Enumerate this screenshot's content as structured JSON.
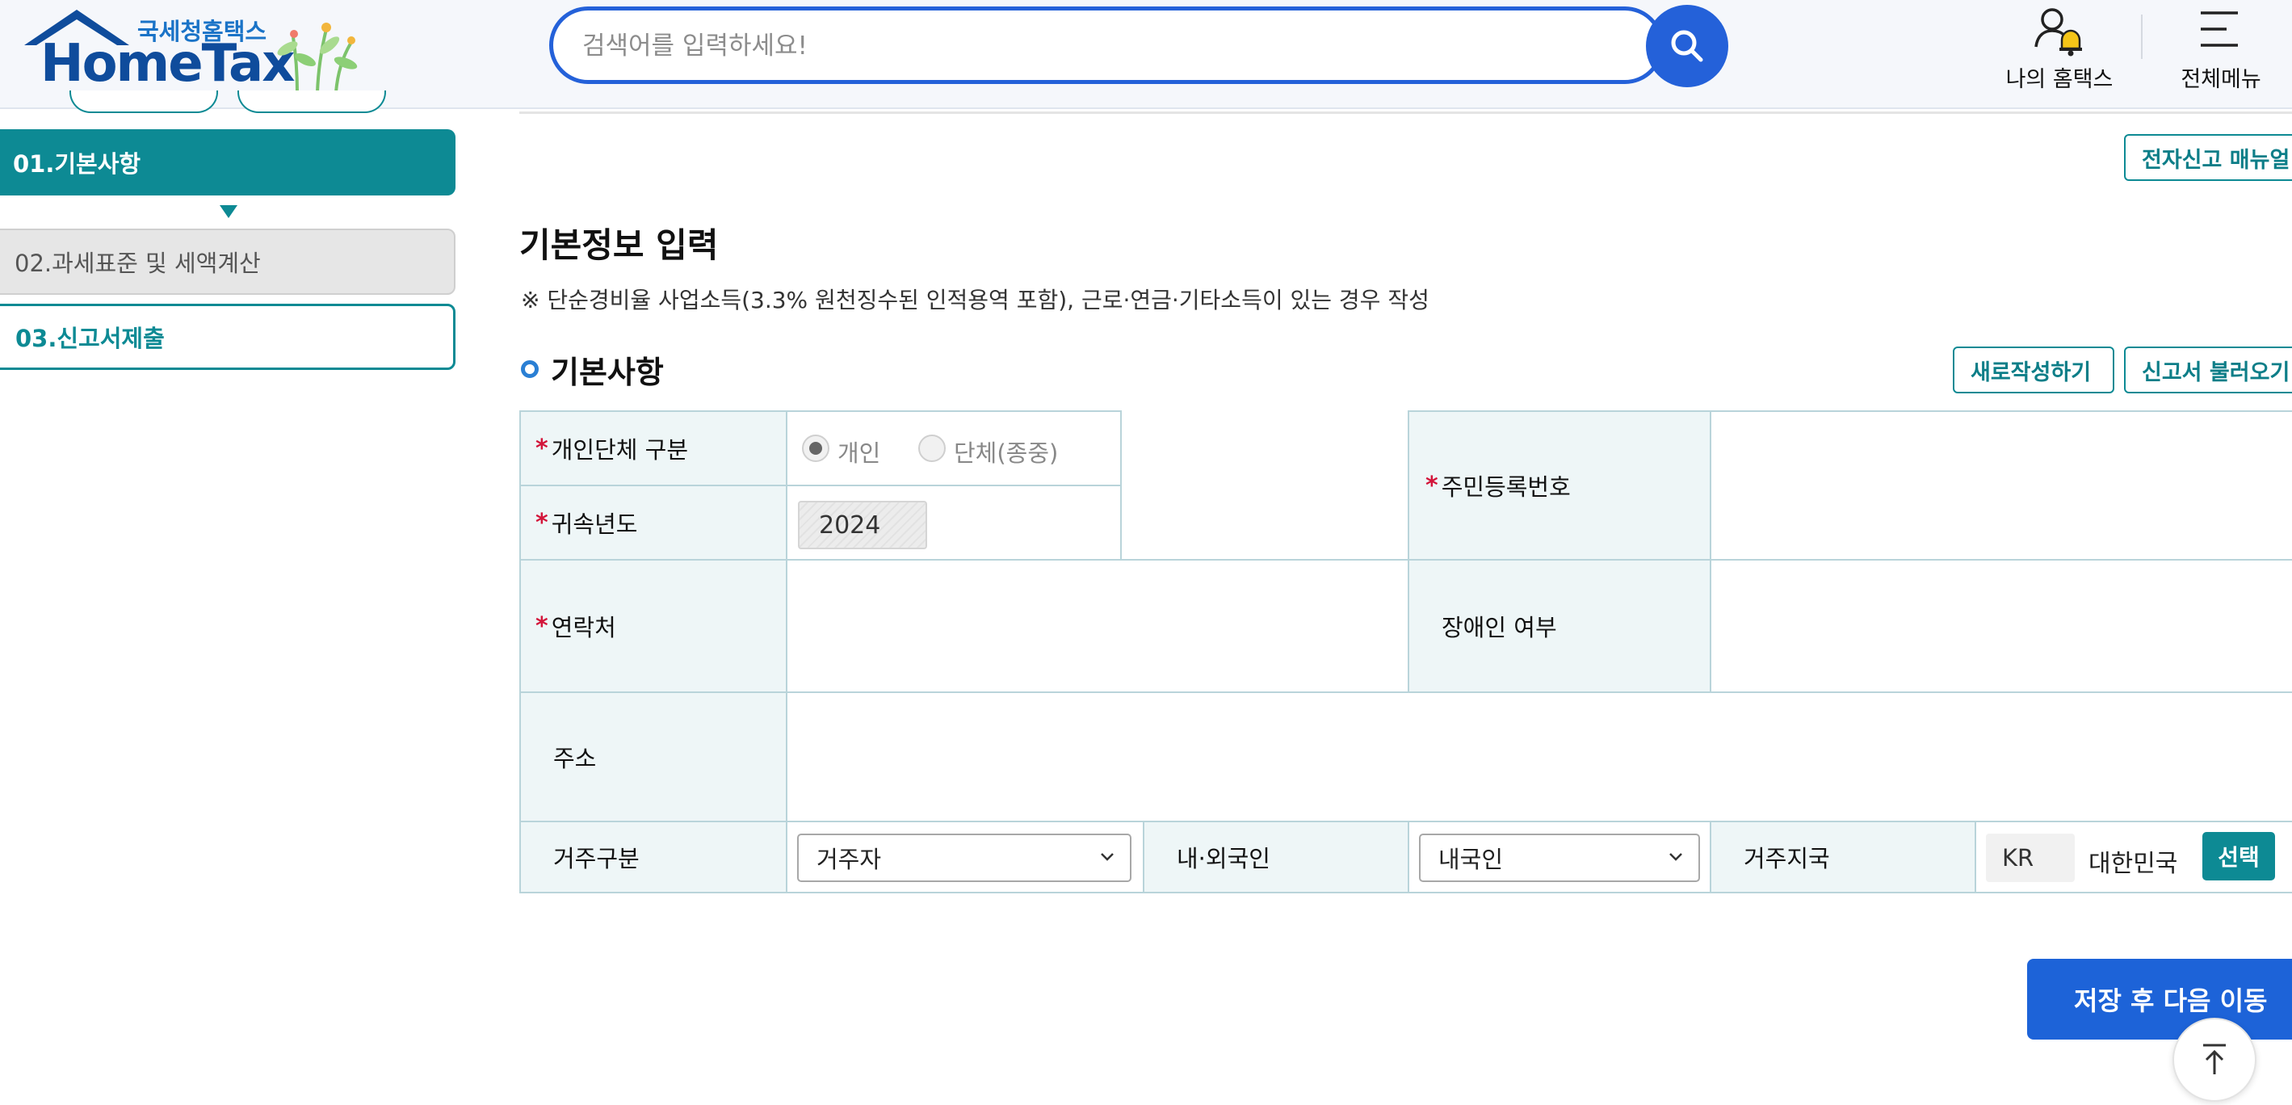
{
  "header": {
    "logo_sub": "국세청홈택스",
    "logo_main": "HomeTax",
    "search": {
      "placeholder": "검색어를 입력하세요!"
    },
    "my_hometax_label": "나의 홈택스",
    "all_menu_label": "전체메뉴"
  },
  "sidebar": {
    "steps": [
      {
        "label": "01.기본사항",
        "state": "active"
      },
      {
        "label": "02.과세표준 및 세액계산",
        "state": "disabled"
      },
      {
        "label": "03.신고서제출",
        "state": "enabled"
      }
    ]
  },
  "main": {
    "manual_button": "전자신고 매뉴얼",
    "title": "기본정보 입력",
    "note": "※ 단순경비율 사업소득(3.3% 원천징수된 인적용역 포함), 근로·연금·기타소득이 있는 경우 작성",
    "section_title": "기본사항",
    "new_button": "새로작성하기",
    "load_button": "신고서 불러오기"
  },
  "form": {
    "type_label": "개인단체 구분",
    "type_options": [
      "개인",
      "단체(종중)"
    ],
    "type_selected": "개인",
    "year_label": "귀속년도",
    "year_value": "2024",
    "rrn_label": "주민등록번호",
    "contact_label": "연락처",
    "disabled_label": "장애인 여부",
    "address_label": "주소",
    "residence_label": "거주구분",
    "residence_value": "거주자",
    "nationality_label": "내·외국인",
    "nationality_value": "내국인",
    "country_label": "거주지국",
    "country_code": "KR",
    "country_name": "대한민국",
    "country_select_button": "선택"
  },
  "footer": {
    "save_next_button": "저장 후 다음 이동"
  },
  "colors": {
    "brand_teal": "#0d8a94",
    "primary_blue": "#1d63d8",
    "required_red": "#d3153a",
    "table_header_bg": "#eef6f7"
  }
}
